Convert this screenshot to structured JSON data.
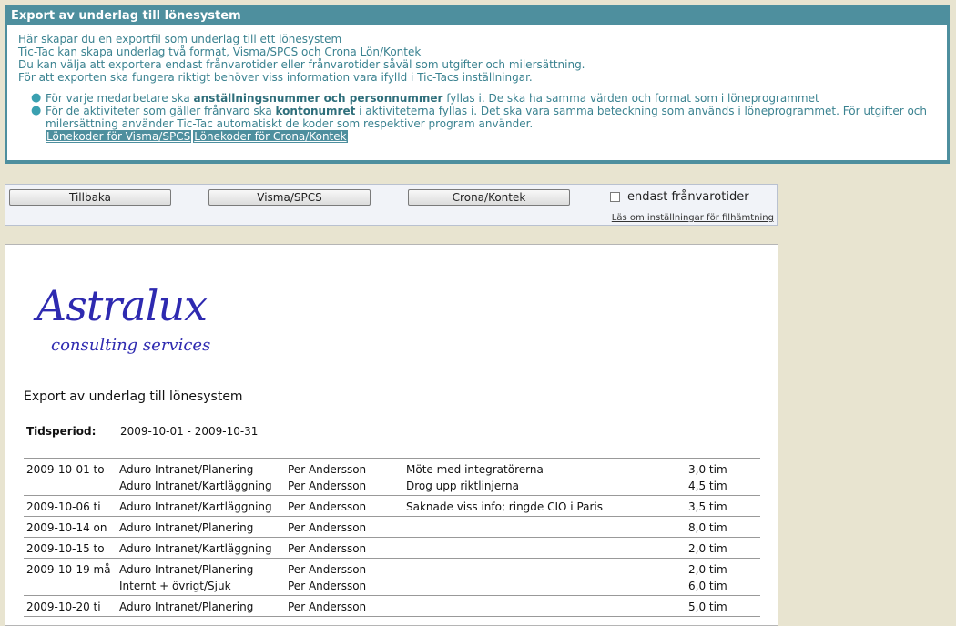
{
  "info": {
    "title": "Export av underlag till lönesystem",
    "lines": [
      "Här skapar du en exportfil som underlag till ett lönesystem",
      "Tic-Tac kan skapa underlag två format, Visma/SPCS och Crona Lön/Kontek",
      "Du kan välja att exportera endast frånvarotider eller frånvarotider såväl som utgifter och milersättning.",
      "För att exporten ska fungera riktigt behöver viss information vara ifylld i Tic-Tacs inställningar."
    ],
    "bullet1": {
      "pre": "För varje medarbetare ska ",
      "bold": "anställningsnummer och personnummer",
      "post": " fyllas i. De ska ha samma värden och format som i löneprogrammet"
    },
    "bullet2": {
      "pre": "För de aktiviteter som gäller frånvaro ska ",
      "bold": "kontonumret",
      "post": " i aktiviteterna fyllas i. Det ska vara samma beteckning som används i löneprogrammet. För utgifter och milersättning använder Tic-Tac automatiskt de koder som respektiver program använder."
    },
    "link_visma": "Lönekoder för Visma/SPCS",
    "link_crona": "Lönekoder för Crona/Kontek"
  },
  "toolbar": {
    "back_label": "Tillbaka",
    "visma_label": "Visma/SPCS",
    "crona_label": "Crona/Kontek",
    "checkbox_label": "endast frånvarotider",
    "settings_link": "Läs om inställningar för filhämtning"
  },
  "report": {
    "logo_main": "Astralux",
    "logo_sub": "consulting services",
    "title": "Export av underlag till lönesystem",
    "period_label": "Tidsperiod:",
    "period_value": "2009-10-01 - 2009-10-31",
    "groups": [
      {
        "lines": [
          {
            "date": "2009-10-01 to",
            "project": "Aduro Intranet/Planering",
            "name": "Per Andersson",
            "note": "Möte med integratörerna",
            "hours": "3,0 tim"
          },
          {
            "date": "",
            "project": "Aduro Intranet/Kartläggning",
            "name": "Per Andersson",
            "note": "Drog upp riktlinjerna",
            "hours": "4,5 tim"
          }
        ]
      },
      {
        "lines": [
          {
            "date": "2009-10-06 ti",
            "project": "Aduro Intranet/Kartläggning",
            "name": "Per Andersson",
            "note": "Saknade viss info; ringde CIO i Paris",
            "hours": "3,5 tim"
          }
        ]
      },
      {
        "lines": [
          {
            "date": "2009-10-14 on",
            "project": "Aduro Intranet/Planering",
            "name": "Per Andersson",
            "note": "",
            "hours": "8,0 tim"
          }
        ]
      },
      {
        "lines": [
          {
            "date": "2009-10-15 to",
            "project": "Aduro Intranet/Kartläggning",
            "name": "Per Andersson",
            "note": "",
            "hours": "2,0 tim"
          }
        ]
      },
      {
        "lines": [
          {
            "date": "2009-10-19 må",
            "project": "Aduro Intranet/Planering",
            "name": "Per Andersson",
            "note": "",
            "hours": "2,0 tim"
          },
          {
            "date": "",
            "project": "Internt + övrigt/Sjuk",
            "name": "Per Andersson",
            "note": "",
            "hours": "6,0 tim"
          }
        ]
      },
      {
        "lines": [
          {
            "date": "2009-10-20 ti",
            "project": "Aduro Intranet/Planering",
            "name": "Per Andersson",
            "note": "",
            "hours": "5,0 tim"
          }
        ]
      }
    ]
  }
}
